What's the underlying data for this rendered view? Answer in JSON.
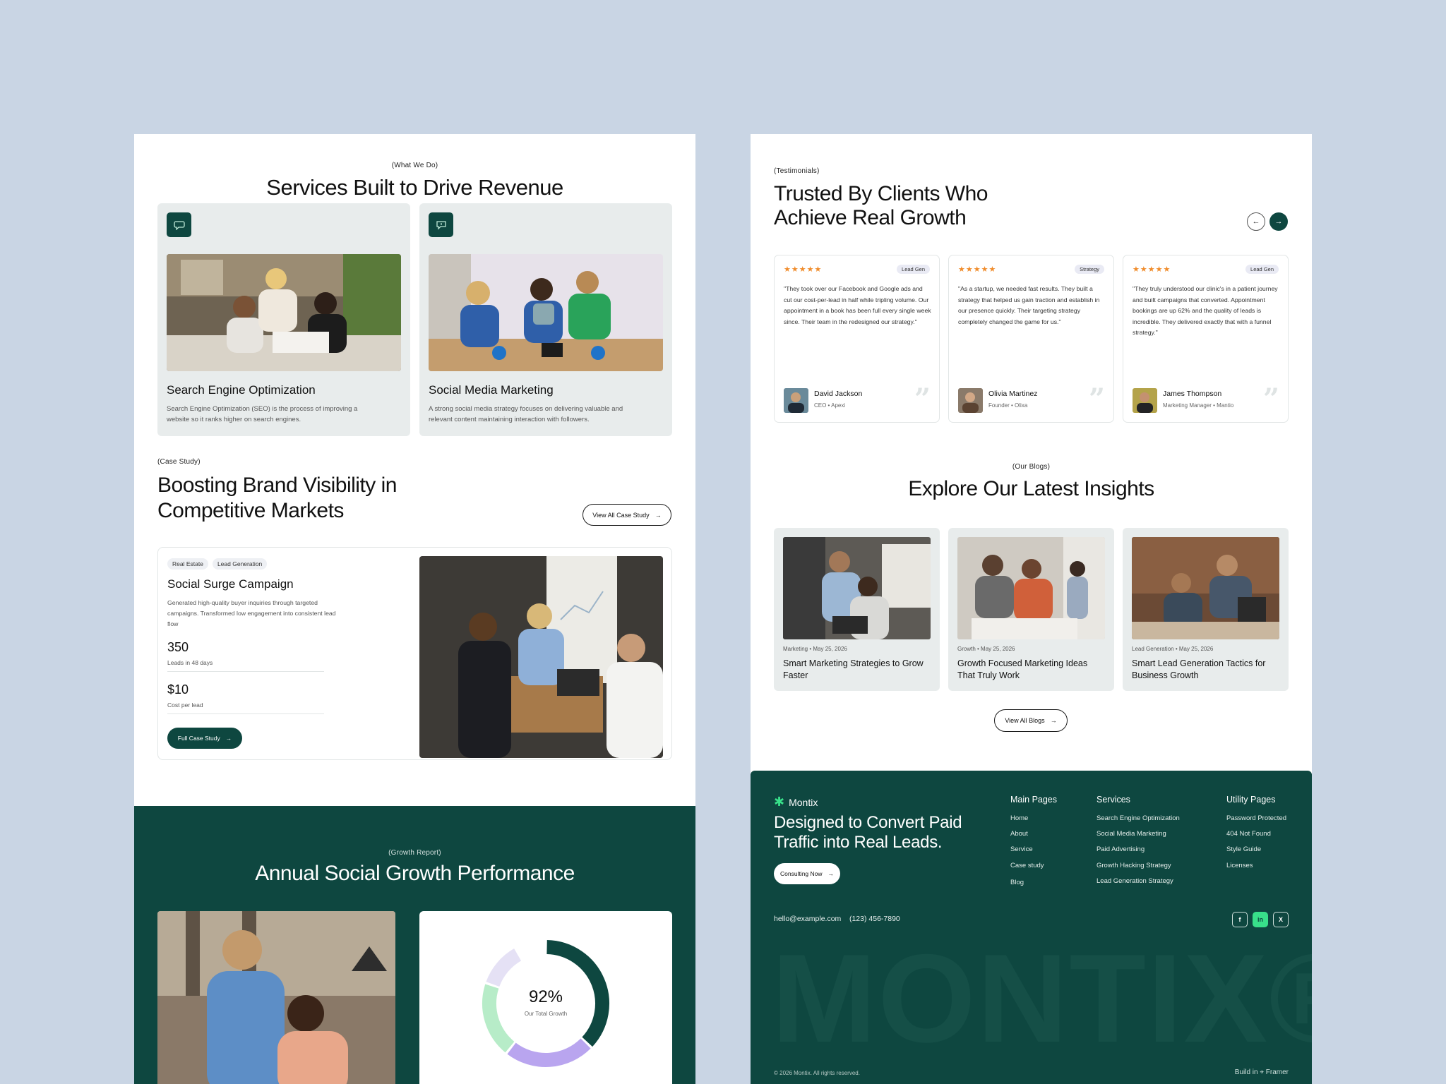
{
  "services": {
    "tag": "(What We Do)",
    "title": "Services Built to Drive Revenue",
    "items": [
      {
        "icon": "chat-bubble-icon",
        "name": "Search Engine Optimization",
        "desc": "Search Engine Optimization (SEO) is the process of improving a website so it ranks higher on search engines."
      },
      {
        "icon": "message-icon",
        "name": "Social Media Marketing",
        "desc": "A strong social media strategy focuses on delivering valuable and relevant content maintaining interaction with followers."
      }
    ]
  },
  "case": {
    "tag": "(Case Study)",
    "title": "Boosting Brand Visibility in Competitive Markets",
    "view_all": "View All Case Study",
    "chips": [
      "Real Estate",
      "Lead Generation"
    ],
    "name": "Social Surge Campaign",
    "desc": "Generated high-quality buyer inquiries through targeted campaigns. Transformed low engagement into consistent lead flow",
    "stats": [
      {
        "value": "350",
        "label": "Leads in 48 days"
      },
      {
        "value": "$10",
        "label": "Cost per lead"
      }
    ],
    "button": "Full Case Study"
  },
  "growth": {
    "tag": "(Growth Report)",
    "title": "Annual Social Growth Performance",
    "donut_value": "92%",
    "donut_label": "Our Total Growth",
    "donut_fraction": 0.92
  },
  "testimonials": {
    "tag": "(Testimonials)",
    "title": "Trusted By Clients Who Achieve Real Growth",
    "items": [
      {
        "stars": "★★★★★",
        "badge": "Lead Gen",
        "quote": "\"They took over our Facebook and Google ads and cut our cost-per-lead in half while tripling volume. Our appointment in a book has been full every single week since. Their team in the redesigned our strategy.\"",
        "name": "David Jackson",
        "role": "CEO • Apexi"
      },
      {
        "stars": "★★★★★",
        "badge": "Strategy",
        "quote": "\"As a startup, we needed fast results. They built a strategy that helped us gain traction and establish in our presence quickly. Their targeting strategy completely changed the game for us.\"",
        "name": "Olivia Martinez",
        "role": "Founder • Olixa"
      },
      {
        "stars": "★★★★★",
        "badge": "Lead Gen",
        "quote": "\"They truly understood our clinic's in a patient journey and built campaigns that converted. Appointment bookings are up 62% and the quality of leads is incredible. They delivered exactly that with a funnel strategy.\"",
        "name": "James Thompson",
        "role": "Marketing Manager • Mantio"
      }
    ]
  },
  "blogs": {
    "tag": "(Our Blogs)",
    "title": "Explore Our Latest Insights",
    "items": [
      {
        "meta": "Marketing • May 25, 2026",
        "name": "Smart Marketing Strategies to Grow Faster"
      },
      {
        "meta": "Growth • May 25, 2026",
        "name": "Growth Focused Marketing Ideas That Truly Work"
      },
      {
        "meta": "Lead Generation • May 25, 2026",
        "name": "Smart Lead Generation Tactics for Business Growth"
      }
    ],
    "view_all": "View All Blogs"
  },
  "footer": {
    "brand": "Montix",
    "headline": "Designed to Convert Paid Traffic into Real Leads.",
    "consult": "Consulting Now",
    "columns": [
      {
        "title": "Main Pages",
        "links": [
          "Home",
          "About",
          "Service",
          "Case study",
          "Blog"
        ]
      },
      {
        "title": "Services",
        "links": [
          "Search Engine Optimization",
          "Social Media Marketing",
          "Paid Advertising",
          "Growth Hacking Strategy",
          "Lead Generation Strategy"
        ]
      },
      {
        "title": "Utility Pages",
        "links": [
          "Password Protected",
          "404 Not Found",
          "Style Guide",
          "Licenses"
        ]
      }
    ],
    "email": "hello@example.com",
    "phone": "(123) 456-7890",
    "social": [
      "facebook-icon",
      "linkedin-icon",
      "x-icon"
    ],
    "big_word": "MONTIX®",
    "copyright": "© 2026 Montix. All rights reserved.",
    "build": "Build in ⌖ Framer"
  },
  "colors": {
    "brand": "#0e4740",
    "accent": "#38e08a",
    "star": "#f08c2b",
    "background": "#c9d5e4"
  }
}
